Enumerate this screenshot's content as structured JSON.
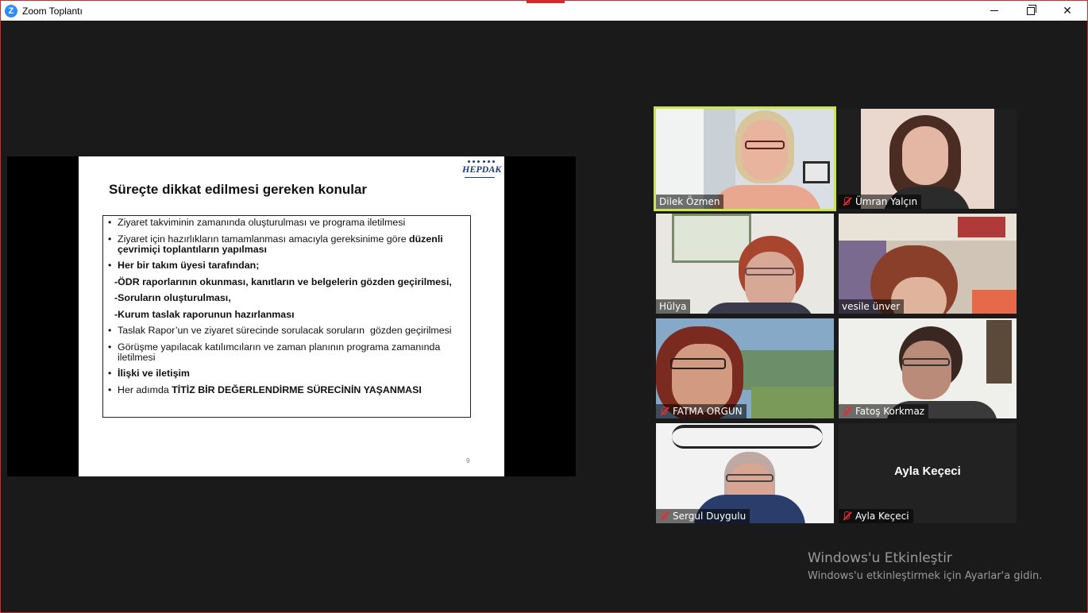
{
  "window": {
    "title": "Zoom Toplantı",
    "app_icon": "zoom-icon",
    "controls": [
      "minimize-icon",
      "restore-icon",
      "close-icon"
    ],
    "close_glyph": "✕"
  },
  "shared_slide": {
    "logo": "HEPDAK",
    "title": "Süreçte dikkat edilmesi gereken konular",
    "bullets": [
      {
        "bullet": "•",
        "text": "Ziyaret takviminin zamanında oluşturulması ve programa iletilmesi"
      },
      {
        "bullet": "•",
        "text": "Ziyaret için hazırlıkların tamamlanması amacıyla gereksinime göre ",
        "bold": "düzenli çevrimiçi toplantıların yapılması"
      },
      {
        "bullet": "•",
        "bold": "Her bir takım üyesi tarafından;"
      },
      {
        "bold": "-ÖDR raporlarının okunması, kanıtların ve belgelerin gözden geçirilmesi,"
      },
      {
        "bold": "-Soruların oluşturulması,"
      },
      {
        "bold": "-Kurum taslak raporunun hazırlanması"
      },
      {
        "bullet": "•",
        "text": "Taslak Rapor’un ve ziyaret sürecinde sorulacak soruların  gözden geçirilmesi"
      },
      {
        "bullet": "•",
        "text": "Görüşme yapılacak katılımcıların ve zaman planının programa zamanında iletilmesi"
      },
      {
        "bullet": "•",
        "bold": "İlişki ve iletişim"
      },
      {
        "bullet": "•",
        "text": "Her adımda ",
        "bold": "TİTİZ BİR DEĞERLENDİRME SÜRECİNİN YAŞANMASI"
      }
    ],
    "page_number": "9"
  },
  "participants": [
    {
      "name": "Dilek Özmen",
      "muted": false,
      "active_speaker": true
    },
    {
      "name": "Ümran Yalçın",
      "muted": true
    },
    {
      "name": "Hülya",
      "muted": false
    },
    {
      "name": "vesile ünver",
      "muted": false
    },
    {
      "name": "FATMA ORGUN",
      "muted": true
    },
    {
      "name": "Fatoş Korkmaz",
      "muted": true
    },
    {
      "name": "Sergul Duygulu",
      "muted": true
    },
    {
      "name": "Ayla Keçeci",
      "muted": true,
      "video_off": true
    }
  ],
  "watermark": {
    "title": "Windows'u Etkinleştir",
    "subtitle": "Windows'u etkinleştirmek için Ayarlar'a gidin."
  }
}
